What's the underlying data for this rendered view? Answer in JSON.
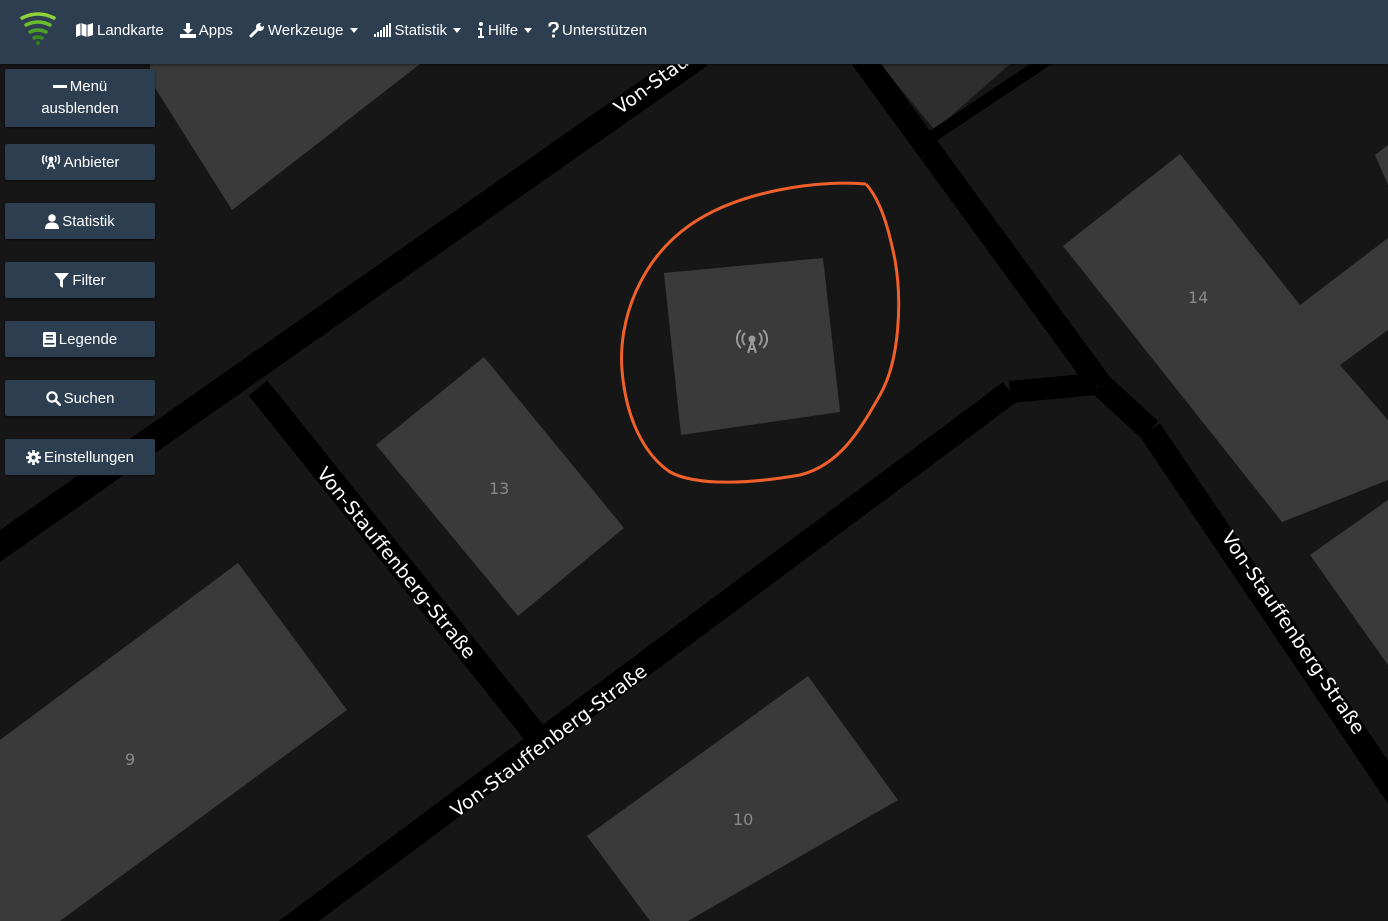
{
  "navbar": {
    "items": [
      {
        "label": "Landkarte",
        "icon": "map-icon",
        "dropdown": false
      },
      {
        "label": "Apps",
        "icon": "download-icon",
        "dropdown": false
      },
      {
        "label": "Werkzeuge",
        "icon": "wrench-icon",
        "dropdown": true
      },
      {
        "label": "Statistik",
        "icon": "signal-bars-icon",
        "dropdown": true
      },
      {
        "label": "Hilfe",
        "icon": "info-icon",
        "dropdown": true
      },
      {
        "label": "Unterstützen",
        "icon": "question-icon",
        "dropdown": false
      }
    ]
  },
  "sidebar": {
    "menu_line1": "Menü",
    "menu_line2": "ausblenden",
    "buttons": [
      {
        "label": "Anbieter",
        "icon": "antenna-icon"
      },
      {
        "label": "Statistik",
        "icon": "user-icon"
      },
      {
        "label": "Filter",
        "icon": "filter-icon"
      },
      {
        "label": "Legende",
        "icon": "book-icon"
      },
      {
        "label": "Suchen",
        "icon": "search-icon"
      },
      {
        "label": "Einstellungen",
        "icon": "gear-icon"
      }
    ]
  },
  "map": {
    "street_labels": [
      "Von-Stau",
      "Von-Stauffenberg-Straße",
      "Von-Stauffenberg-Straße",
      "Von-Stauffenberg-Straße"
    ],
    "house_numbers": [
      "14",
      "13",
      "9",
      "10"
    ],
    "annotation_color": "#f0602a",
    "road_color": "#000000",
    "building_color": "#3a3a3a"
  }
}
